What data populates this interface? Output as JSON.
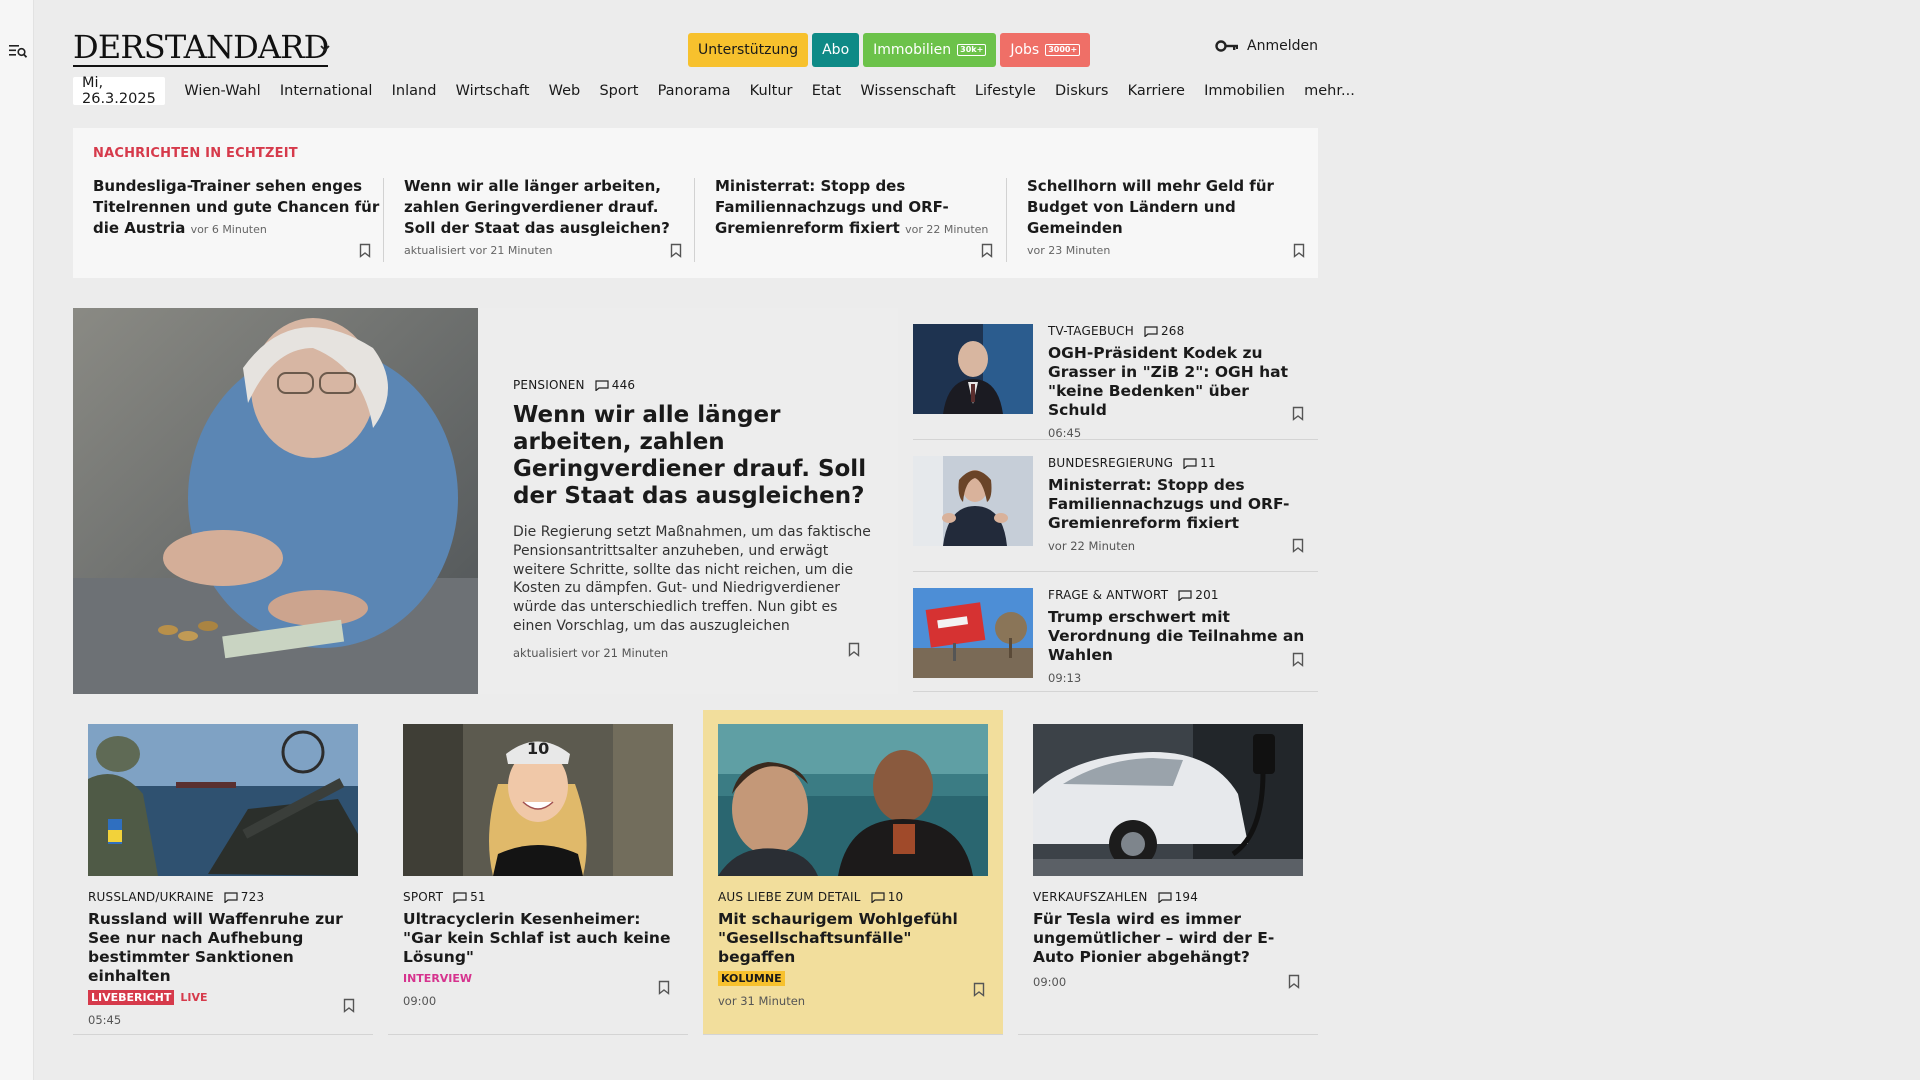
{
  "brand": {
    "logo": "DERSTANDARD"
  },
  "header": {
    "pills": [
      {
        "label": "Unterstützung"
      },
      {
        "label": "Abo"
      },
      {
        "label": "Immobilien",
        "count": "30k+"
      },
      {
        "label": "Jobs",
        "count": "3000+"
      }
    ],
    "login": "Anmelden"
  },
  "nav": {
    "date": "Mi, 26.3.2025",
    "items": [
      "Wien-Wahl",
      "International",
      "Inland",
      "Wirtschaft",
      "Web",
      "Sport",
      "Panorama",
      "Kultur",
      "Etat",
      "Wissenschaft",
      "Lifestyle",
      "Diskurs",
      "Karriere",
      "Immobilien",
      "mehr..."
    ]
  },
  "ticker": {
    "label": "NACHRICHTEN IN ECHTZEIT",
    "items": [
      {
        "title": "Bundesliga-Trainer sehen enges Titelrennen und gute Chancen für die Austria",
        "time": "vor 6 Minuten"
      },
      {
        "title": "Wenn wir alle länger arbeiten, zahlen Geringverdiener drauf. Soll der Staat das ausgleichen?",
        "time": "aktualisiert vor 21 Minuten"
      },
      {
        "title": "Ministerrat: Stopp des Familiennachzugs und ORF-Gremienreform fixiert",
        "time": "vor 22 Minuten"
      },
      {
        "title": "Schellhorn will mehr Geld für Budget von Ländern und Gemeinden",
        "time": "vor 23 Minuten"
      }
    ]
  },
  "hero": {
    "kicker": "PENSIONEN",
    "comments": "446",
    "title": "Wenn wir alle länger arbeiten, zahlen Geringverdiener drauf. Soll der Staat das ausgleichen?",
    "description": "Die Regierung setzt Maßnahmen, um das faktische Pensionsantrittsalter anzuheben, und erwägt weitere Schritte, sollte das nicht reichen, um die Kosten zu dämpfen. Gut- und Niedrigverdiener würde das unterschiedlich treffen. Nun gibt es einen Vorschlag, um das auszugleichen",
    "meta": "aktualisiert vor 21 Minuten"
  },
  "side": [
    {
      "kicker": "TV-TAGEBUCH",
      "comments": "268",
      "title": "OGH-Präsident Kodek zu Grasser in \"ZiB 2\": OGH hat \"keine Bedenken\" über Schuld",
      "time": "06:45"
    },
    {
      "kicker": "BUNDESREGIERUNG",
      "comments": "11",
      "title": "Ministerrat: Stopp des Familiennachzugs und ORF-Gremienreform fixiert",
      "time": "vor 22 Minuten"
    },
    {
      "kicker": "FRAGE & ANTWORT",
      "comments": "201",
      "title": "Trump erschwert mit Verordnung die Teilnahme an Wahlen",
      "time": "09:13"
    }
  ],
  "cards": [
    {
      "kicker": "RUSSLAND/UKRAINE",
      "comments": "723",
      "title": "Russland will Waffenruhe zur See nur nach Aufhebung bestimmter Sanktionen einhalten",
      "tag": "LIVEBERICHT",
      "tag2": "LIVE",
      "time": "05:45"
    },
    {
      "kicker": "SPORT",
      "comments": "51",
      "title": "Ultracyclerin Kesenheimer: \"Gar kein Schlaf ist auch keine Lösung\"",
      "tag": "INTERVIEW",
      "time": "09:00"
    },
    {
      "kicker": "AUS LIEBE ZUM DETAIL",
      "comments": "10",
      "title": "Mit schaurigem Wohlgefühl \"Gesellschaftsunfälle\" begaffen",
      "tag": "KOLUMNE",
      "time": "vor 31 Minuten"
    },
    {
      "kicker": "VERKAUFSZAHLEN",
      "comments": "194",
      "title": "Für Tesla wird es immer ungemütlicher – wird der E-Auto Pionier abgehängt?",
      "time": "09:00"
    }
  ]
}
